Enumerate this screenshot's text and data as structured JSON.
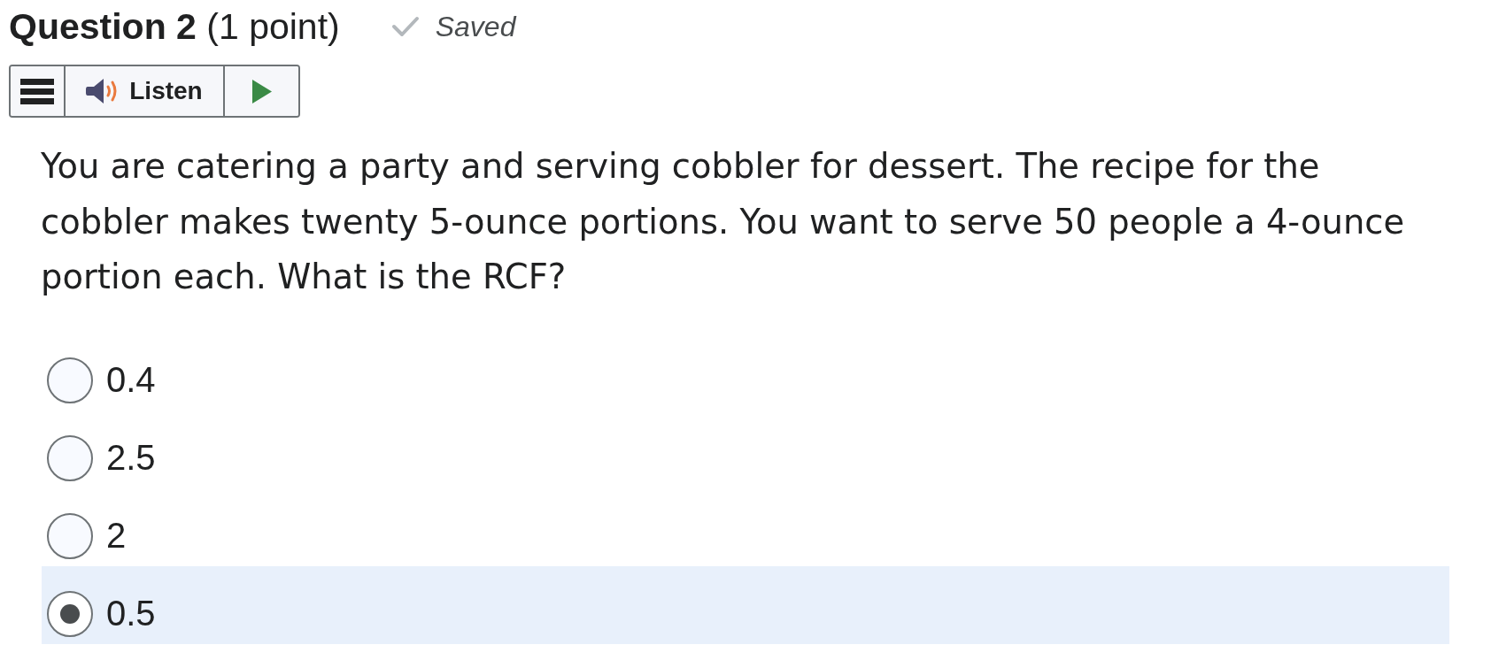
{
  "question": {
    "title": "Question 2",
    "points": "(1 point)",
    "save_status": "Saved"
  },
  "toolbar": {
    "listen_label": "Listen"
  },
  "prompt": "You are catering a party and serving cobbler for dessert. The recipe for the cobbler makes twenty 5-ounce portions. You want to serve 50 people a 4-ounce portion each. What is the RCF?",
  "options": [
    {
      "label": "0.4",
      "selected": false
    },
    {
      "label": "2.5",
      "selected": false
    },
    {
      "label": "2",
      "selected": false
    },
    {
      "label": "0.5",
      "selected": true
    }
  ]
}
